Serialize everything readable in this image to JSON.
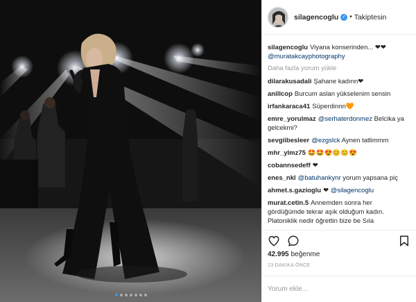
{
  "header": {
    "username": "silagencoglu",
    "follow_status": "Takiptesin"
  },
  "comments": [
    {
      "user": "silagencoglu",
      "text": "Viyana konserinden... ❤❤",
      "mention": "@muratakcayphotography"
    },
    {
      "more_label": "Daha fazla yorum yükle"
    },
    {
      "user": "dilarakusadali",
      "text": "Şahane kadınn❤"
    },
    {
      "user": "anillcop",
      "text": "Burcum aslan yükselenim sensin"
    },
    {
      "user": "irfankaraca41",
      "text": "Süperdinnn🧡"
    },
    {
      "user": "emre_yorulmaz",
      "mention": "@serhaterdonmez",
      "text": "Belcika ya gelcekmi?"
    },
    {
      "user": "sevgiibesleer",
      "mention": "@ezgslck",
      "text": "Aynen tatlimmm"
    },
    {
      "user": "mhr_ylmz75",
      "text": "🤩🤩😍😊😊😍"
    },
    {
      "user": "cobannsedeff",
      "text": "❤"
    },
    {
      "user": "enes_nkl",
      "mention": "@batuhankynr",
      "text": "yorum yapsana piç"
    },
    {
      "user": "ahmet.s.gazioglu",
      "text": "❤",
      "mention": "@silagencoglu"
    },
    {
      "user": "murat.cetin.5",
      "text": "Annemden sonra her gördüğümde tekrar aşık olduğum kadın. Platoniklik nedir öğrettin bize be Sıla"
    }
  ],
  "likes": {
    "count": "42.995",
    "label": "beğenme"
  },
  "timestamp": "23 DAKİKA ÖNCE",
  "add_comment": {
    "placeholder": "Yorum ekle..."
  },
  "carousel": {
    "dot_count": 7,
    "active_index": 0
  },
  "colors": {
    "verified_badge": "#3897f0",
    "mention": "#003569",
    "secondary_text": "#999999"
  },
  "icons": [
    "heart-icon",
    "comment-icon",
    "bookmark-icon",
    "verified-icon"
  ]
}
